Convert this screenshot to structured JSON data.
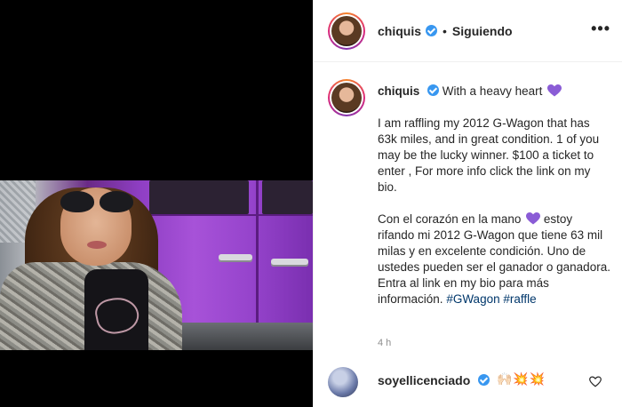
{
  "post": {
    "username": "chiquis",
    "separator": "•",
    "follow_status": "Siguiendo",
    "more_label": "•••",
    "caption_heading": "With a heavy heart",
    "caption_en": "I am raffling my 2012 G-Wagon that has 63k miles, and in great condition. 1 of you may be the lucky winner. $100 a ticket to enter , For more info click the link on my bio.",
    "caption_es_1": "Con el corazón en la mano",
    "caption_es_2": "estoy rifando mi 2012 G-Wagon que tiene 63 mil milas y en excelente condición. Uno de ustedes pueden ser el ganador o ganadora. Entra al link en my bio para más información.",
    "hashtags": "#GWagon #raffle",
    "time": "4 h",
    "heart_color": "#8a5cd6"
  },
  "comment": {
    "username": "soyellicenciado",
    "emoji": "🙌🏻💥💥"
  },
  "colors": {
    "verified": "#3897f0",
    "hashtag": "#00376b",
    "muted": "#8e8e8e"
  }
}
